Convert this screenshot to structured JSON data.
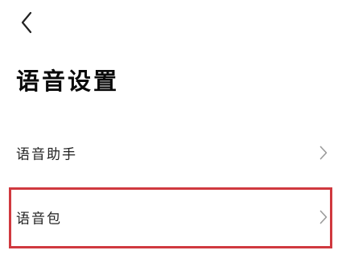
{
  "header": {
    "back_icon": "chevron-left-icon",
    "title": "语音设置"
  },
  "settings": {
    "items": [
      {
        "label": "语音助手",
        "icon": "chevron-right-icon",
        "highlighted": false
      },
      {
        "label": "语音包",
        "icon": "chevron-right-icon",
        "highlighted": true
      }
    ]
  },
  "colors": {
    "highlight": "#d0393f",
    "chevron": "#9a9a9a",
    "text": "#111111",
    "background": "#ffffff"
  }
}
